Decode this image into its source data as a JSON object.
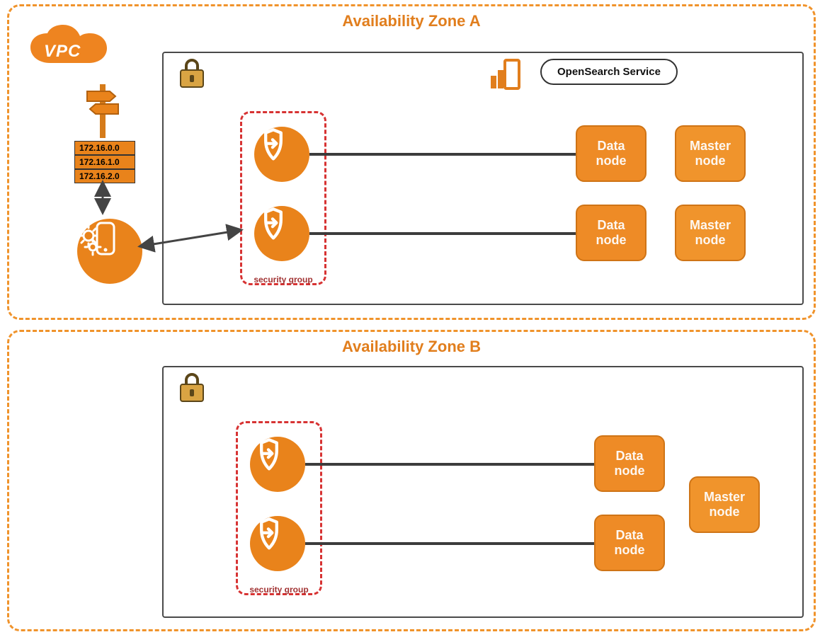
{
  "vpc_label": "VPC",
  "service_label": "OpenSearch Service",
  "zones": [
    {
      "title": "Availability Zone A",
      "sg_label": "security group",
      "nodes": [
        "Data node",
        "Data node",
        "Master node",
        "Master node"
      ]
    },
    {
      "title": "Availability Zone B",
      "sg_label": "security group",
      "nodes": [
        "Data node",
        "Data node",
        "Master node"
      ]
    }
  ],
  "ip_addresses": [
    "172.16.0.0",
    "172.16.1.0",
    "172.16.2.0"
  ]
}
